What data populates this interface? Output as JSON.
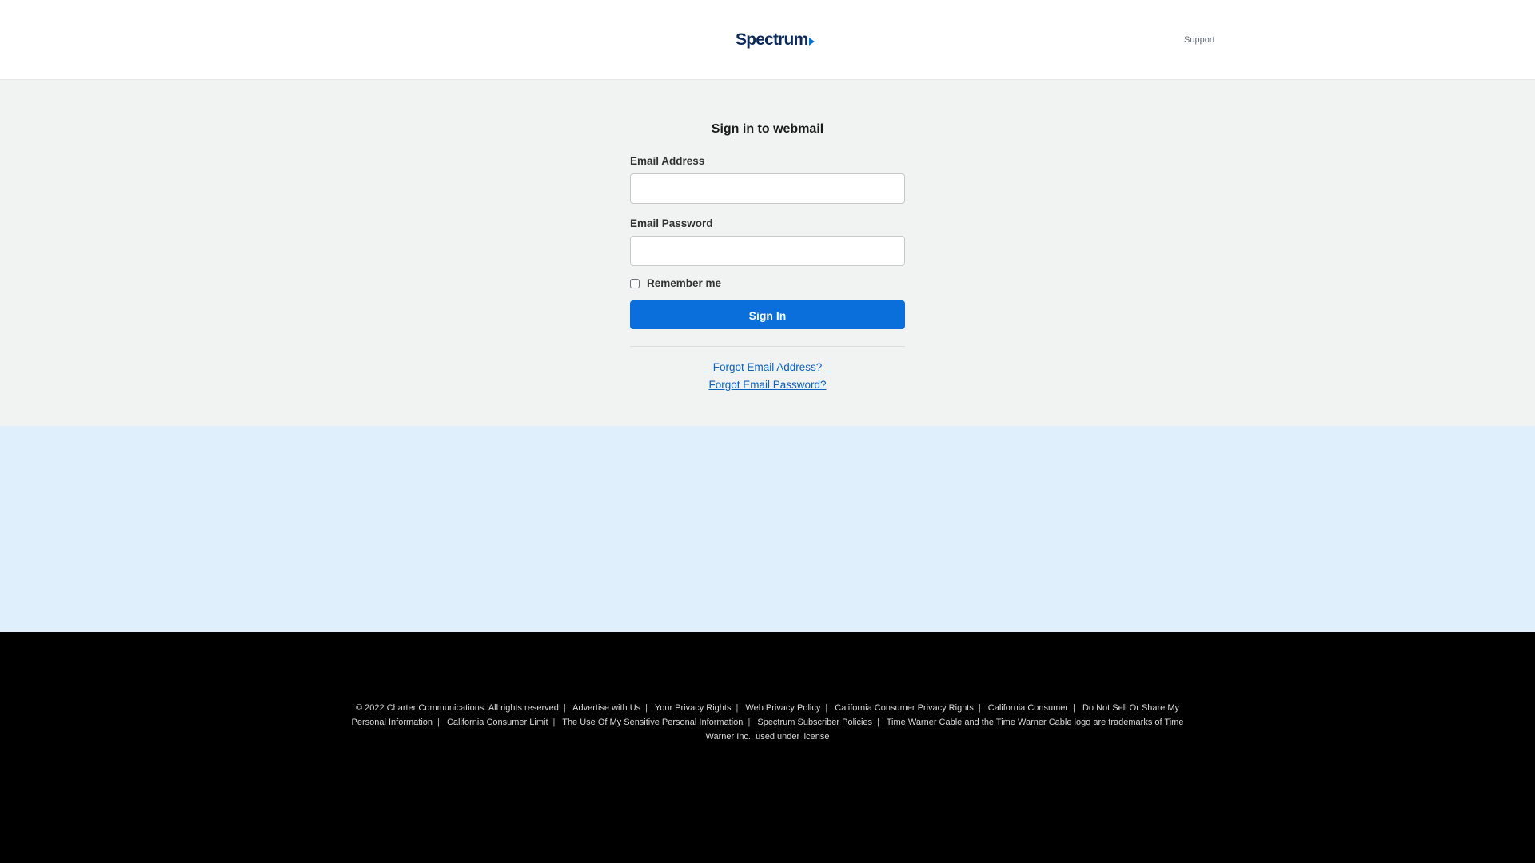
{
  "header": {
    "logo_text": "Spectrum",
    "support_label": "Support"
  },
  "signin": {
    "title": "Sign in to webmail",
    "email_label": "Email Address",
    "email_value": "",
    "password_label": "Email Password",
    "password_value": "",
    "remember_label": "Remember me",
    "remember_checked": false,
    "button_label": "Sign In",
    "forgot_email": "Forgot Email Address?",
    "forgot_password": "Forgot Email Password?"
  },
  "footer": {
    "copyright": "© 2022 Charter Communications. All rights reserved",
    "links": [
      "Advertise with Us",
      "Your Privacy Rights",
      "Web Privacy Policy",
      "California Consumer Privacy Rights",
      "California Consumer",
      "Do Not Sell Or Share My Personal Information",
      "California Consumer Limit",
      "The Use Of My Sensitive Personal Information",
      "Spectrum Subscriber Policies"
    ],
    "trademark": "Time Warner Cable and the Time Warner Cable logo are trademarks of Time Warner Inc., used under license"
  },
  "colors": {
    "accent": "#0a6fdb",
    "link": "#0a62c2",
    "brand_dark": "#0b2a5b",
    "main_bg": "#f1f2f2",
    "promo_bg": "#dff0fc",
    "footer_bg": "#000000"
  }
}
